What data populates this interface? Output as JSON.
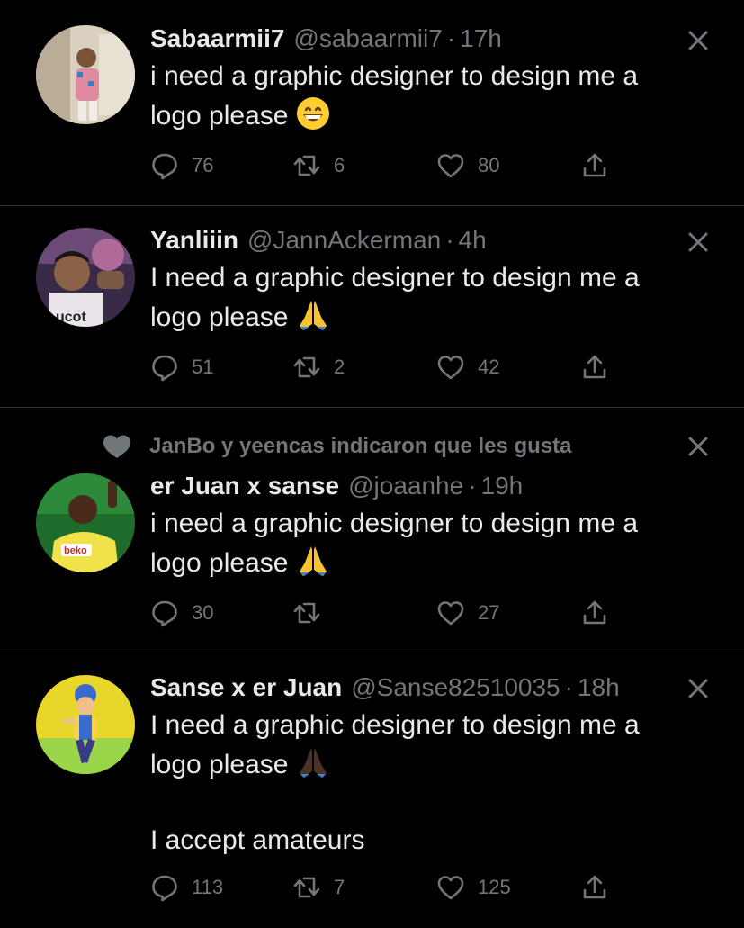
{
  "tweets": [
    {
      "name": "Sabaarmii7",
      "handle": "@sabaarmii7",
      "dot": "·",
      "time": "17h",
      "text_lines": [
        "i need a graphic designer to design me a",
        "logo please"
      ],
      "emoji": "grinning-face-emoji",
      "replies": "76",
      "retweets": "6",
      "likes": "80",
      "avatar_color": "#cfc5b4"
    },
    {
      "name": "Yanliiin",
      "handle": "@JannAckerman",
      "dot": "·",
      "time": "4h",
      "text_lines": [
        "I need a graphic designer to design me a",
        "logo please"
      ],
      "emoji": "folded-hands-emoji",
      "replies": "51",
      "retweets": "2",
      "likes": "42",
      "avatar_color": "#5a3a5e"
    },
    {
      "social_context": "JanBo y yeencas indicaron que les gusta",
      "name": "er Juan x sanse",
      "handle": "@joaanhe",
      "dot": "·",
      "time": "19h",
      "text_lines": [
        "i need a graphic designer to design me a",
        "logo please"
      ],
      "emoji": "folded-hands-emoji",
      "replies": "30",
      "retweets": "",
      "likes": "27",
      "avatar_color": "#1e6a2a"
    },
    {
      "name": "Sanse x er Juan",
      "handle": "@Sanse82510035",
      "dot": "·",
      "time": "18h",
      "text_lines": [
        "I need a graphic designer to design me a",
        "logo please"
      ],
      "extra_line": "I accept amateurs",
      "emoji": "folded-hands-dark-emoji",
      "replies": "113",
      "retweets": "7",
      "likes": "125",
      "avatar_color": "#e6cf2a"
    }
  ],
  "colors": {
    "background": "#000000",
    "text": "#e7e9ea",
    "muted": "#71767b",
    "divider": "#2f3336"
  }
}
